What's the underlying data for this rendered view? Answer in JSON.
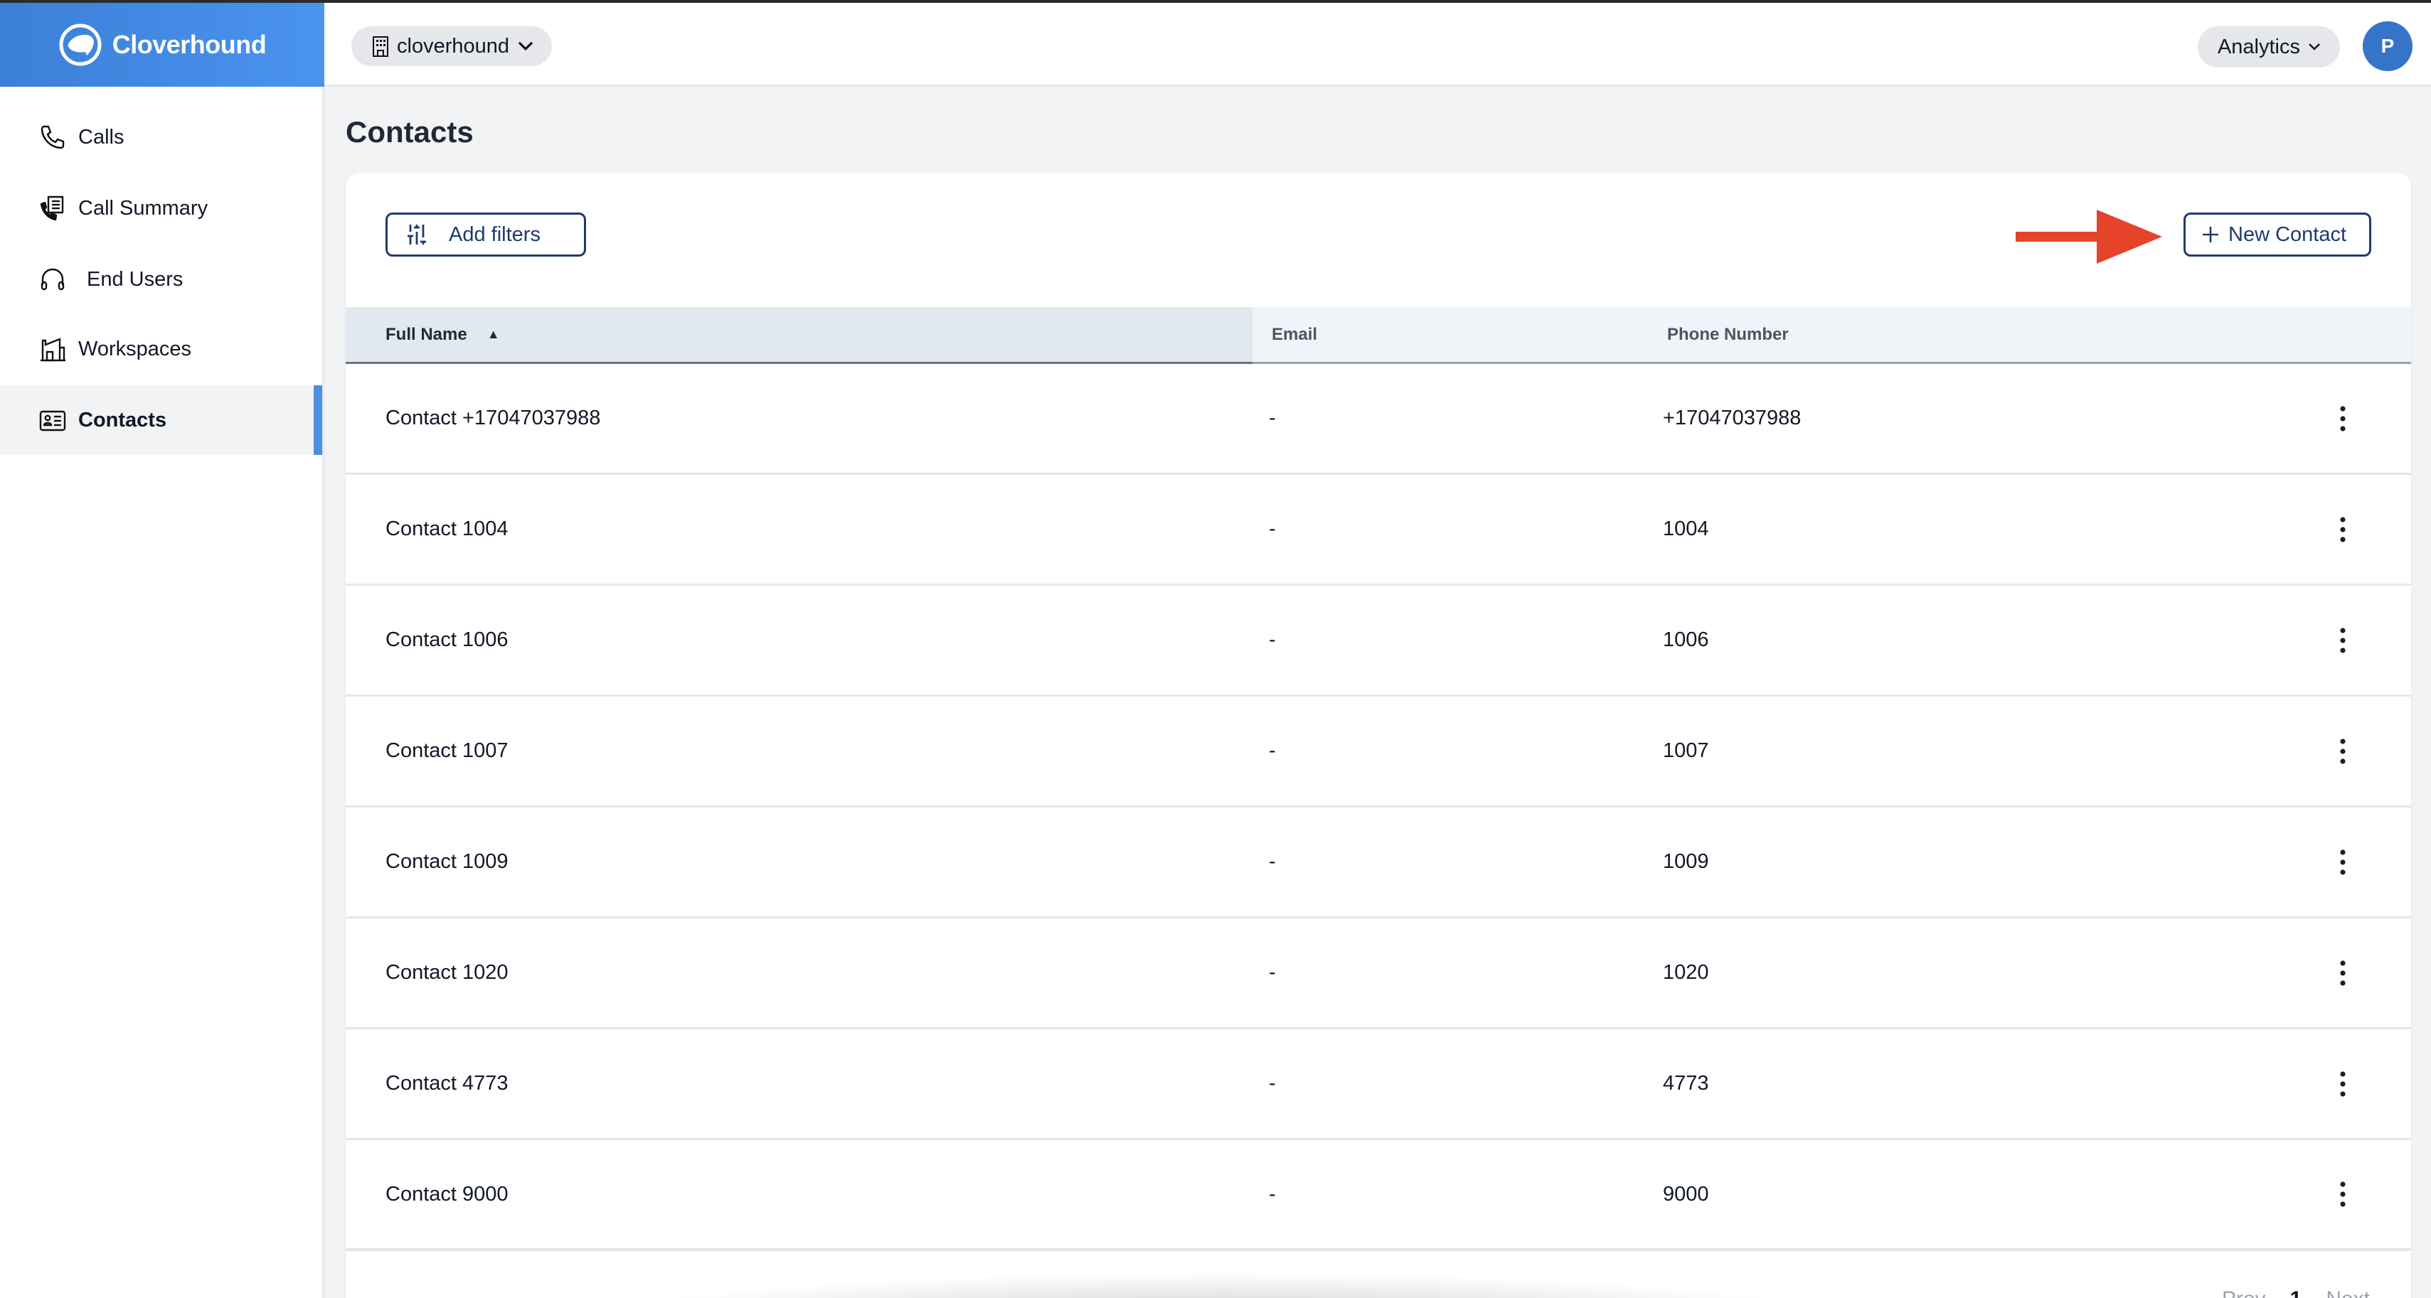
{
  "app": {
    "brand_name": "Cloverhound",
    "accent_color": "#4a8fe0",
    "annotation_color": "#e5432a"
  },
  "header": {
    "org_selector": "cloverhound",
    "analytics_menu": "Analytics",
    "avatar_initial": "P"
  },
  "sidebar": {
    "items": [
      {
        "label": "Calls",
        "icon": "phone-icon",
        "active": false
      },
      {
        "label": "Call Summary",
        "icon": "phone-list-icon",
        "active": false
      },
      {
        "label": "End Users",
        "icon": "headphones-icon",
        "active": false
      },
      {
        "label": "Workspaces",
        "icon": "building-icon",
        "active": false
      },
      {
        "label": "Contacts",
        "icon": "contact-card-icon",
        "active": true
      }
    ]
  },
  "main": {
    "title": "Contacts",
    "add_filters_label": "Add filters",
    "new_contact_label": "New Contact",
    "table": {
      "columns": [
        "Full Name",
        "Email",
        "Phone Number"
      ],
      "sort_column": "Full Name",
      "sort_direction": "ascending",
      "rows": [
        {
          "name": "Contact +17047037988",
          "email": "-",
          "phone": "+17047037988"
        },
        {
          "name": "Contact 1004",
          "email": "-",
          "phone": "1004"
        },
        {
          "name": "Contact 1006",
          "email": "-",
          "phone": "1006"
        },
        {
          "name": "Contact 1007",
          "email": "-",
          "phone": "1007"
        },
        {
          "name": "Contact 1009",
          "email": "-",
          "phone": "1009"
        },
        {
          "name": "Contact 1020",
          "email": "-",
          "phone": "1020"
        },
        {
          "name": "Contact 4773",
          "email": "-",
          "phone": "4773"
        },
        {
          "name": "Contact 9000",
          "email": "-",
          "phone": "9000"
        }
      ]
    },
    "pagination": {
      "prev_label": "Prev",
      "current_page": "1",
      "next_label": "Next"
    }
  }
}
